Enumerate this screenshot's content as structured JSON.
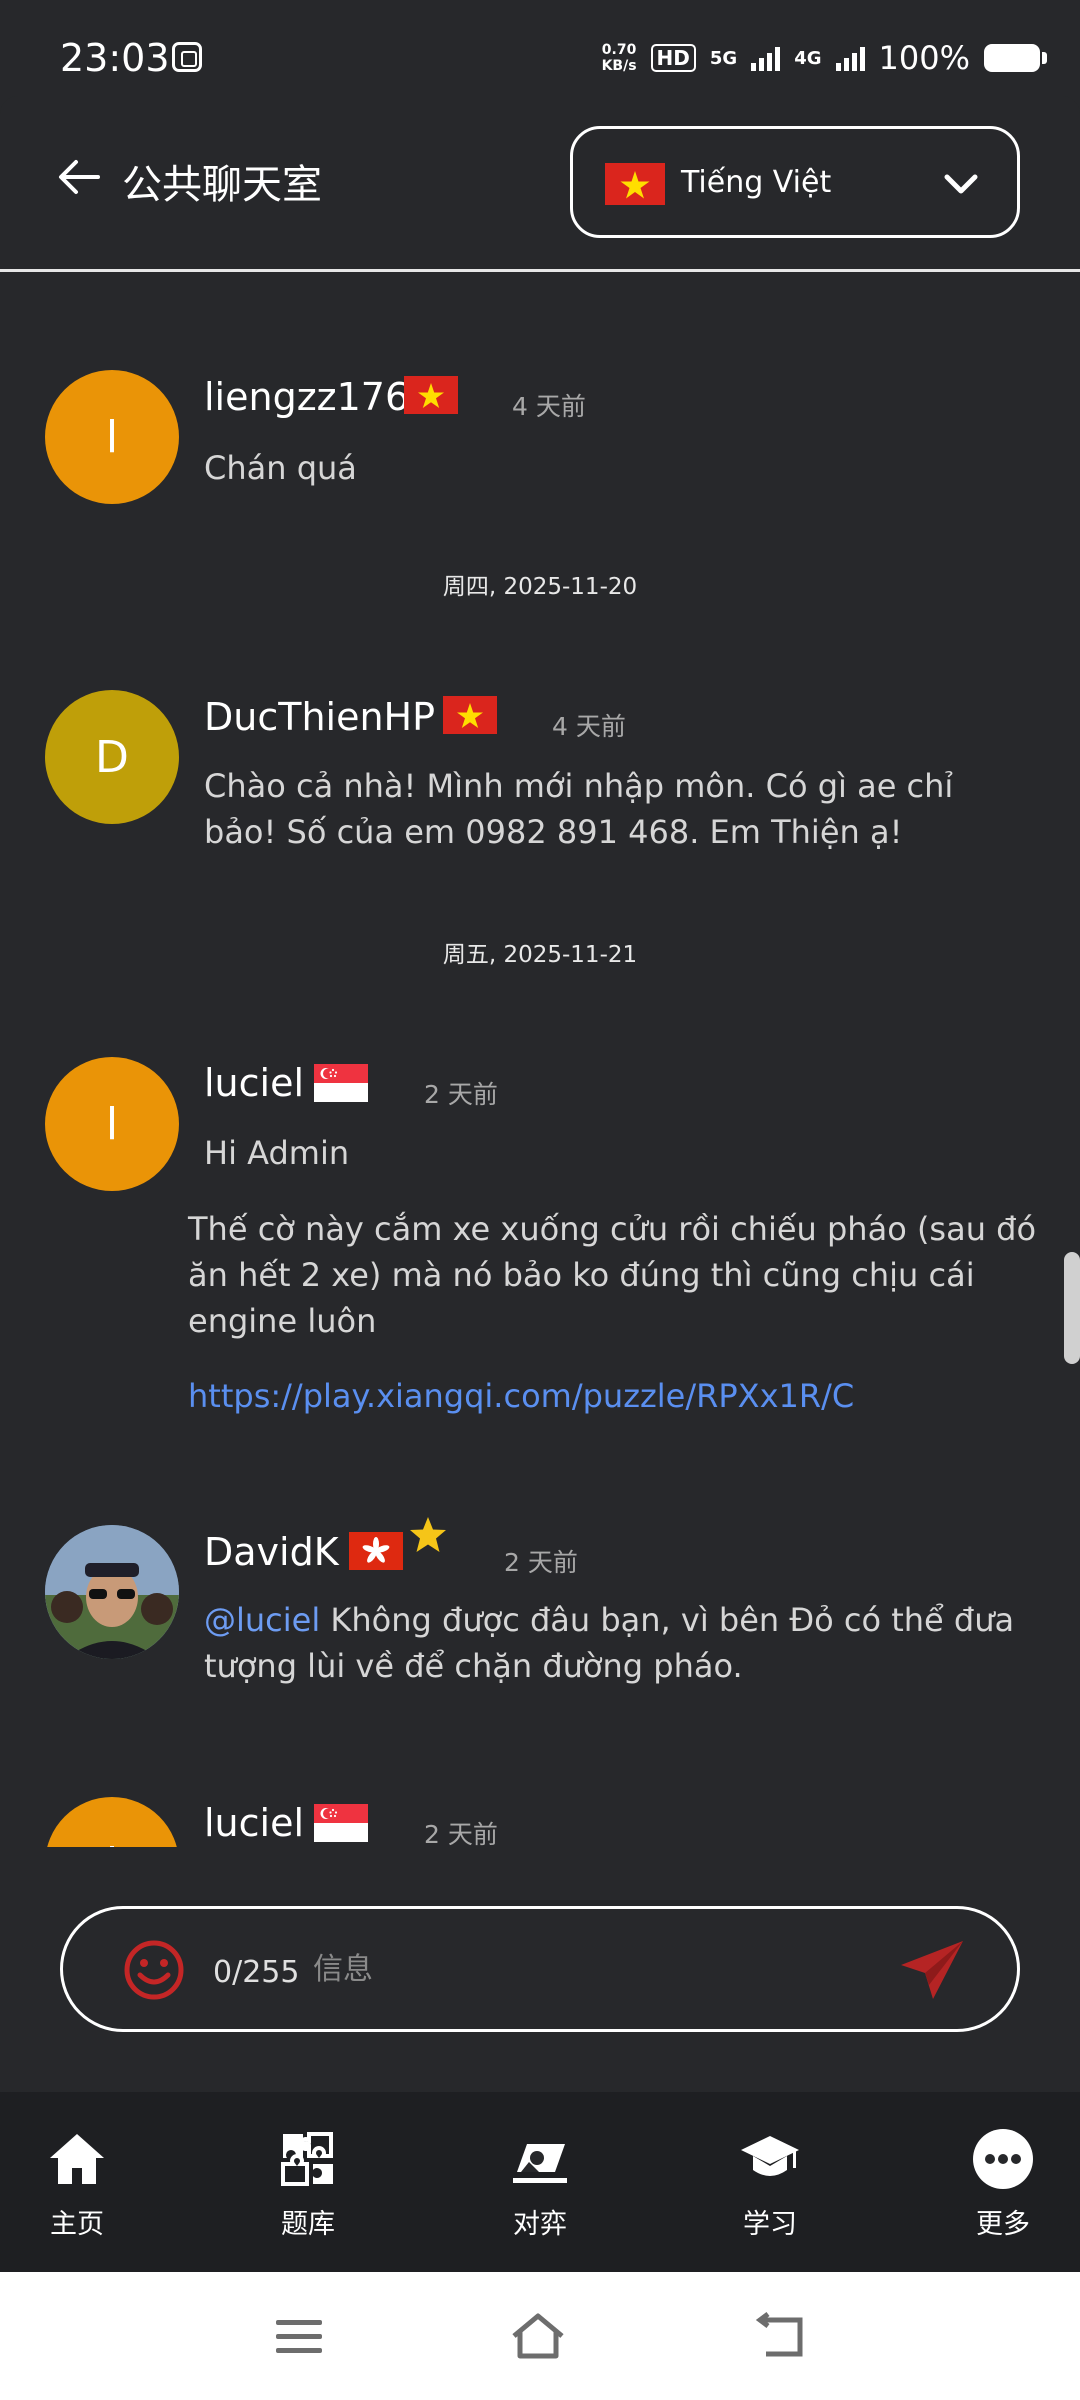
{
  "status_bar": {
    "time": "23:03",
    "speed_value": "0.70",
    "speed_unit": "KB/s",
    "hd_label": "HD",
    "net_5g": "5G",
    "net_4g": "4G",
    "battery": "100%"
  },
  "header": {
    "title": "公共聊天室",
    "language": "Tiếng Việt",
    "back_icon": "back-arrow-icon"
  },
  "messages": [
    {
      "user": "liengzz176",
      "flag": "vietnam-flag",
      "time": "4 天前",
      "initial": "l",
      "avatar_color": "#ea9407",
      "text": "Chán quá"
    },
    {
      "user": "DucThienHP",
      "flag": "vietnam-flag",
      "time": "4 天前",
      "initial": "D",
      "avatar_color": "#bf9f09",
      "text": "Chào cả nhà! Mình mới nhập môn. Có gì ae chỉ bảo! Số của em 0982 891 468. Em Thiện ạ!"
    },
    {
      "user": "luciel",
      "flag": "singapore-flag",
      "time": "2 天前",
      "initial": "l",
      "avatar_color": "#ea9407",
      "text": "Hi Admin",
      "text2": "Thế cờ này cắm xe xuống cửu rồi chiếu pháo (sau đó ăn hết 2 xe) mà nó bảo ko đúng thì cũng chịu cái engine luôn",
      "link": "https://play.xiangqi.com/puzzle/RPXx1R/C"
    },
    {
      "user": "DavidK",
      "flag": "hongkong-flag",
      "time": "2 天前",
      "badge": "star-icon",
      "mention": "@luciel",
      "text": "Không được đâu bạn, vì bên Đỏ có thể đưa tượng lùi về để chặn đường pháo."
    },
    {
      "user": "luciel",
      "flag": "singapore-flag",
      "time": "2 天前",
      "initial": "l",
      "avatar_color": "#ea9407"
    }
  ],
  "date_separators": [
    "周四, 2025-11-20",
    "周五, 2025-11-21"
  ],
  "composer": {
    "counter": "0/255",
    "placeholder": "信息",
    "emoji_icon": "emoji-icon",
    "send_icon": "send-icon"
  },
  "bottom_nav": [
    {
      "label": "主页",
      "icon": "home-icon"
    },
    {
      "label": "题库",
      "icon": "puzzle-icon"
    },
    {
      "label": "对弈",
      "icon": "play-board-icon"
    },
    {
      "label": "学习",
      "icon": "graduation-cap-icon"
    },
    {
      "label": "更多",
      "icon": "more-icon"
    }
  ],
  "colors": {
    "background": "#27282b",
    "orange_avatar": "#ea9407",
    "olive_avatar": "#bf9f09",
    "link": "#5a8ff0",
    "send": "#b52424",
    "emoji": "#c42626"
  }
}
